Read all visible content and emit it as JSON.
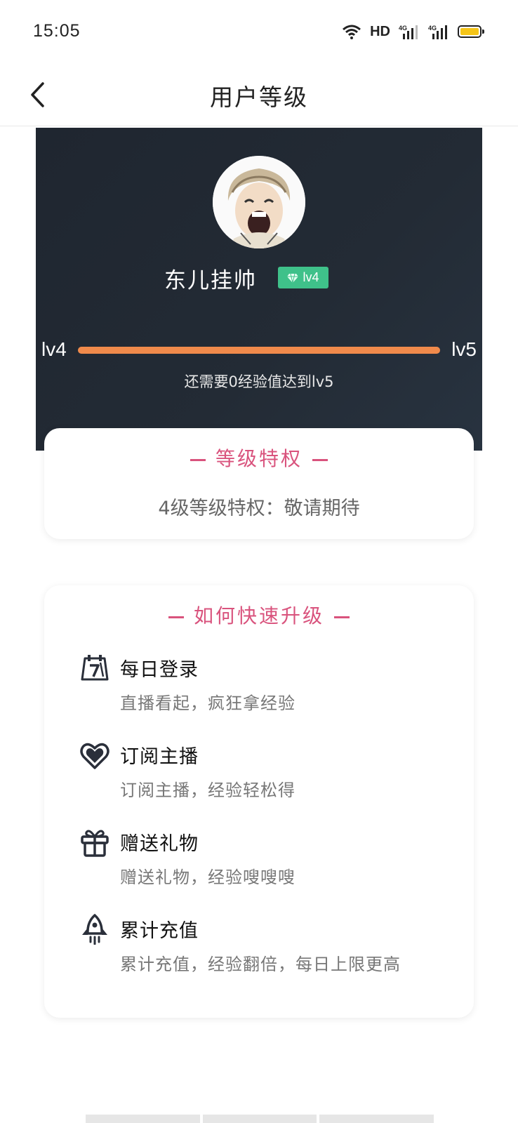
{
  "status_bar": {
    "time": "15:05",
    "network_label": "HD",
    "signal_label": "4G",
    "battery_color": "#f5c518"
  },
  "nav": {
    "title": "用户等级",
    "back_icon": "chevron-left-icon"
  },
  "profile": {
    "username": "东儿挂帅",
    "level_badge": "lv4",
    "badge_icon": "diamond-icon",
    "current_level": "lv4",
    "next_level": "lv5",
    "progress": 1.0,
    "exp_text": "还需要0经验值达到lv5"
  },
  "privilege_card": {
    "title": "等级特权",
    "text": "4级等级特权：敬请期待"
  },
  "upgrade_card": {
    "title": "如何快速升级",
    "tips": [
      {
        "icon": "calendar-icon",
        "title": "每日登录",
        "desc": "直播看起，疯狂拿经验"
      },
      {
        "icon": "heart-icon",
        "title": "订阅主播",
        "desc": "订阅主播，经验轻松得"
      },
      {
        "icon": "gift-icon",
        "title": "赠送礼物",
        "desc": "赠送礼物，经验嗖嗖嗖"
      },
      {
        "icon": "rocket-icon",
        "title": "累计充值",
        "desc": "累计充值，经验翻倍，每日上限更高"
      }
    ]
  },
  "colors": {
    "accent": "#d9537d",
    "progress": "#f08a4b",
    "badge": "#3fc18a",
    "hero_bg": "#1f2630"
  }
}
